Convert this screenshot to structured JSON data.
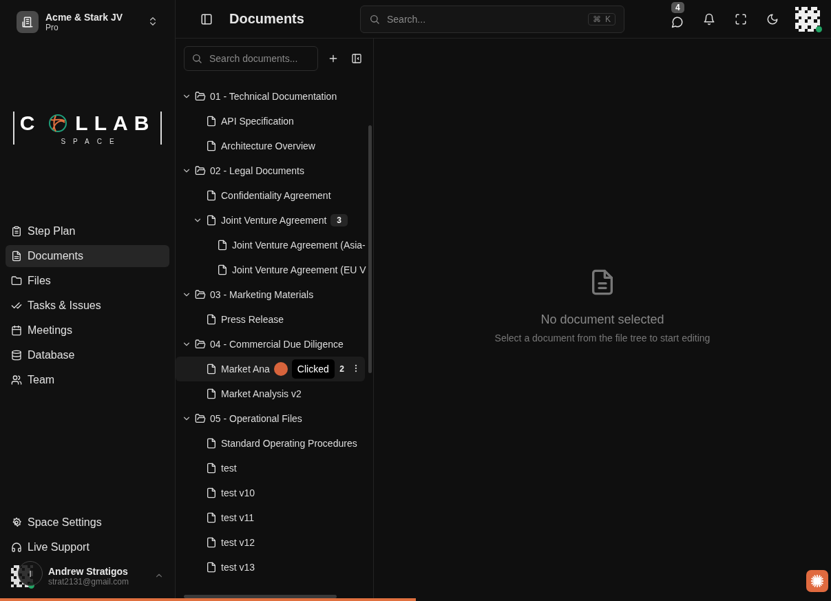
{
  "workspace": {
    "name": "Acme & Stark JV",
    "plan": "Pro"
  },
  "logo": {
    "word_start": "C",
    "word_end": "LLAB",
    "tagline": "SPACE"
  },
  "nav": [
    {
      "label": "Step Plan",
      "selected": false
    },
    {
      "label": "Documents",
      "selected": true
    },
    {
      "label": "Files",
      "selected": false
    },
    {
      "label": "Tasks & Issues",
      "selected": false
    },
    {
      "label": "Meetings",
      "selected": false
    },
    {
      "label": "Database",
      "selected": false
    },
    {
      "label": "Team",
      "selected": false
    }
  ],
  "bottom_nav": [
    {
      "label": "Space Settings"
    },
    {
      "label": "Live Support"
    }
  ],
  "user": {
    "name": "Andrew Stratigos",
    "email": "strat2131@gmail.com",
    "cursor_label": "I",
    "online": true
  },
  "header": {
    "title": "Documents",
    "search_placeholder": "Search...",
    "shortcut": [
      "⌘",
      "K"
    ],
    "message_count": "4",
    "online": true
  },
  "tree_search": {
    "placeholder": "Search documents..."
  },
  "tree": [
    {
      "kind": "folder",
      "label": "01 - Technical Documentation",
      "expanded": true,
      "selected": false,
      "children": [
        {
          "kind": "file",
          "label": "API Specification",
          "selected": false
        },
        {
          "kind": "file",
          "label": "Architecture Overview",
          "selected": false
        }
      ]
    },
    {
      "kind": "folder",
      "label": "02 - Legal Documents",
      "expanded": true,
      "selected": false,
      "children": [
        {
          "kind": "file",
          "label": "Confidentiality Agreement",
          "selected": false
        },
        {
          "kind": "file",
          "label": "Joint Venture Agreement",
          "badge": "3",
          "expanded": true,
          "selected": false,
          "children": [
            {
              "kind": "file",
              "label": "Joint Venture Agreement (Asia-",
              "selected": false
            },
            {
              "kind": "file",
              "label": "Joint Venture Agreement (EU V",
              "selected": false
            }
          ]
        }
      ]
    },
    {
      "kind": "folder",
      "label": "03 - Marketing Materials",
      "expanded": true,
      "selected": false,
      "children": [
        {
          "kind": "file",
          "label": "Press Release",
          "selected": false
        }
      ]
    },
    {
      "kind": "folder",
      "label": "04 - Commercial Due Diligence",
      "expanded": true,
      "selected": false,
      "children": [
        {
          "kind": "file",
          "label": "Market Ana",
          "badge": "2",
          "selected": true,
          "tooltip": "Clicked"
        },
        {
          "kind": "file",
          "label": "Market Analysis v2",
          "selected": false
        }
      ]
    },
    {
      "kind": "folder",
      "label": "05 - Operational Files",
      "expanded": true,
      "selected": false,
      "children": [
        {
          "kind": "file",
          "label": "Standard Operating Procedures",
          "selected": false
        },
        {
          "kind": "file",
          "label": "test",
          "selected": false
        },
        {
          "kind": "file",
          "label": "test v10",
          "selected": false
        },
        {
          "kind": "file",
          "label": "test v11",
          "selected": false
        },
        {
          "kind": "file",
          "label": "test v12",
          "selected": false
        },
        {
          "kind": "file",
          "label": "test v13",
          "selected": false
        }
      ]
    }
  ],
  "empty_state": {
    "title": "No document selected",
    "message": "Select a document from the file tree to start editing"
  },
  "loading_bar": {
    "level": 0.5
  }
}
